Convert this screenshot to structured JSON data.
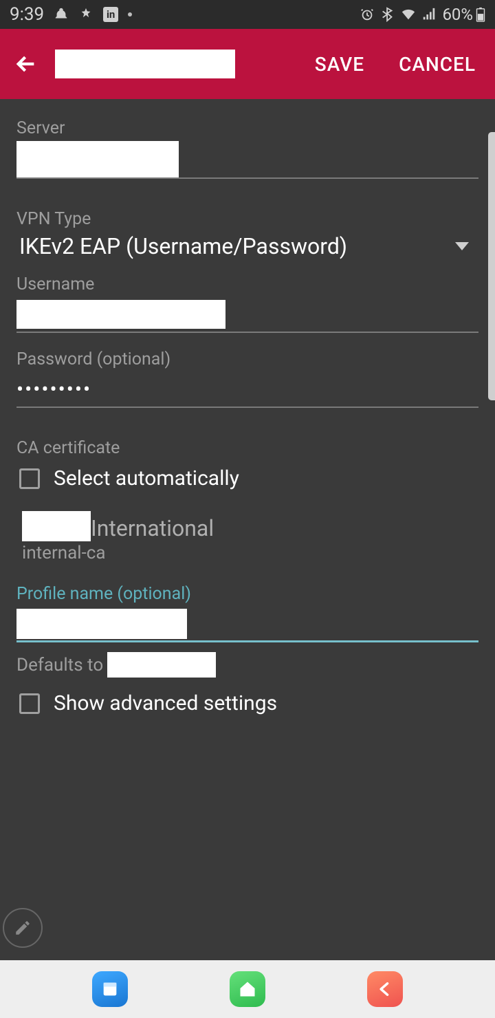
{
  "status": {
    "time": "9:39",
    "battery": "60%"
  },
  "appbar": {
    "save_label": "SAVE",
    "cancel_label": "CANCEL"
  },
  "form": {
    "server_label": "Server",
    "vpn_type_label": "VPN Type",
    "vpn_type_value": "IKEv2 EAP (Username/Password)",
    "username_label": "Username",
    "password_label": "Password (optional)",
    "password_masked": "•••••••••",
    "ca_label": "CA certificate",
    "select_auto_label": "Select automatically",
    "cert_name_suffix": "International",
    "cert_sub": "internal-ca",
    "profile_label": "Profile name (optional)",
    "defaults_prefix": "Defaults to",
    "advanced_label": "Show advanced settings"
  }
}
